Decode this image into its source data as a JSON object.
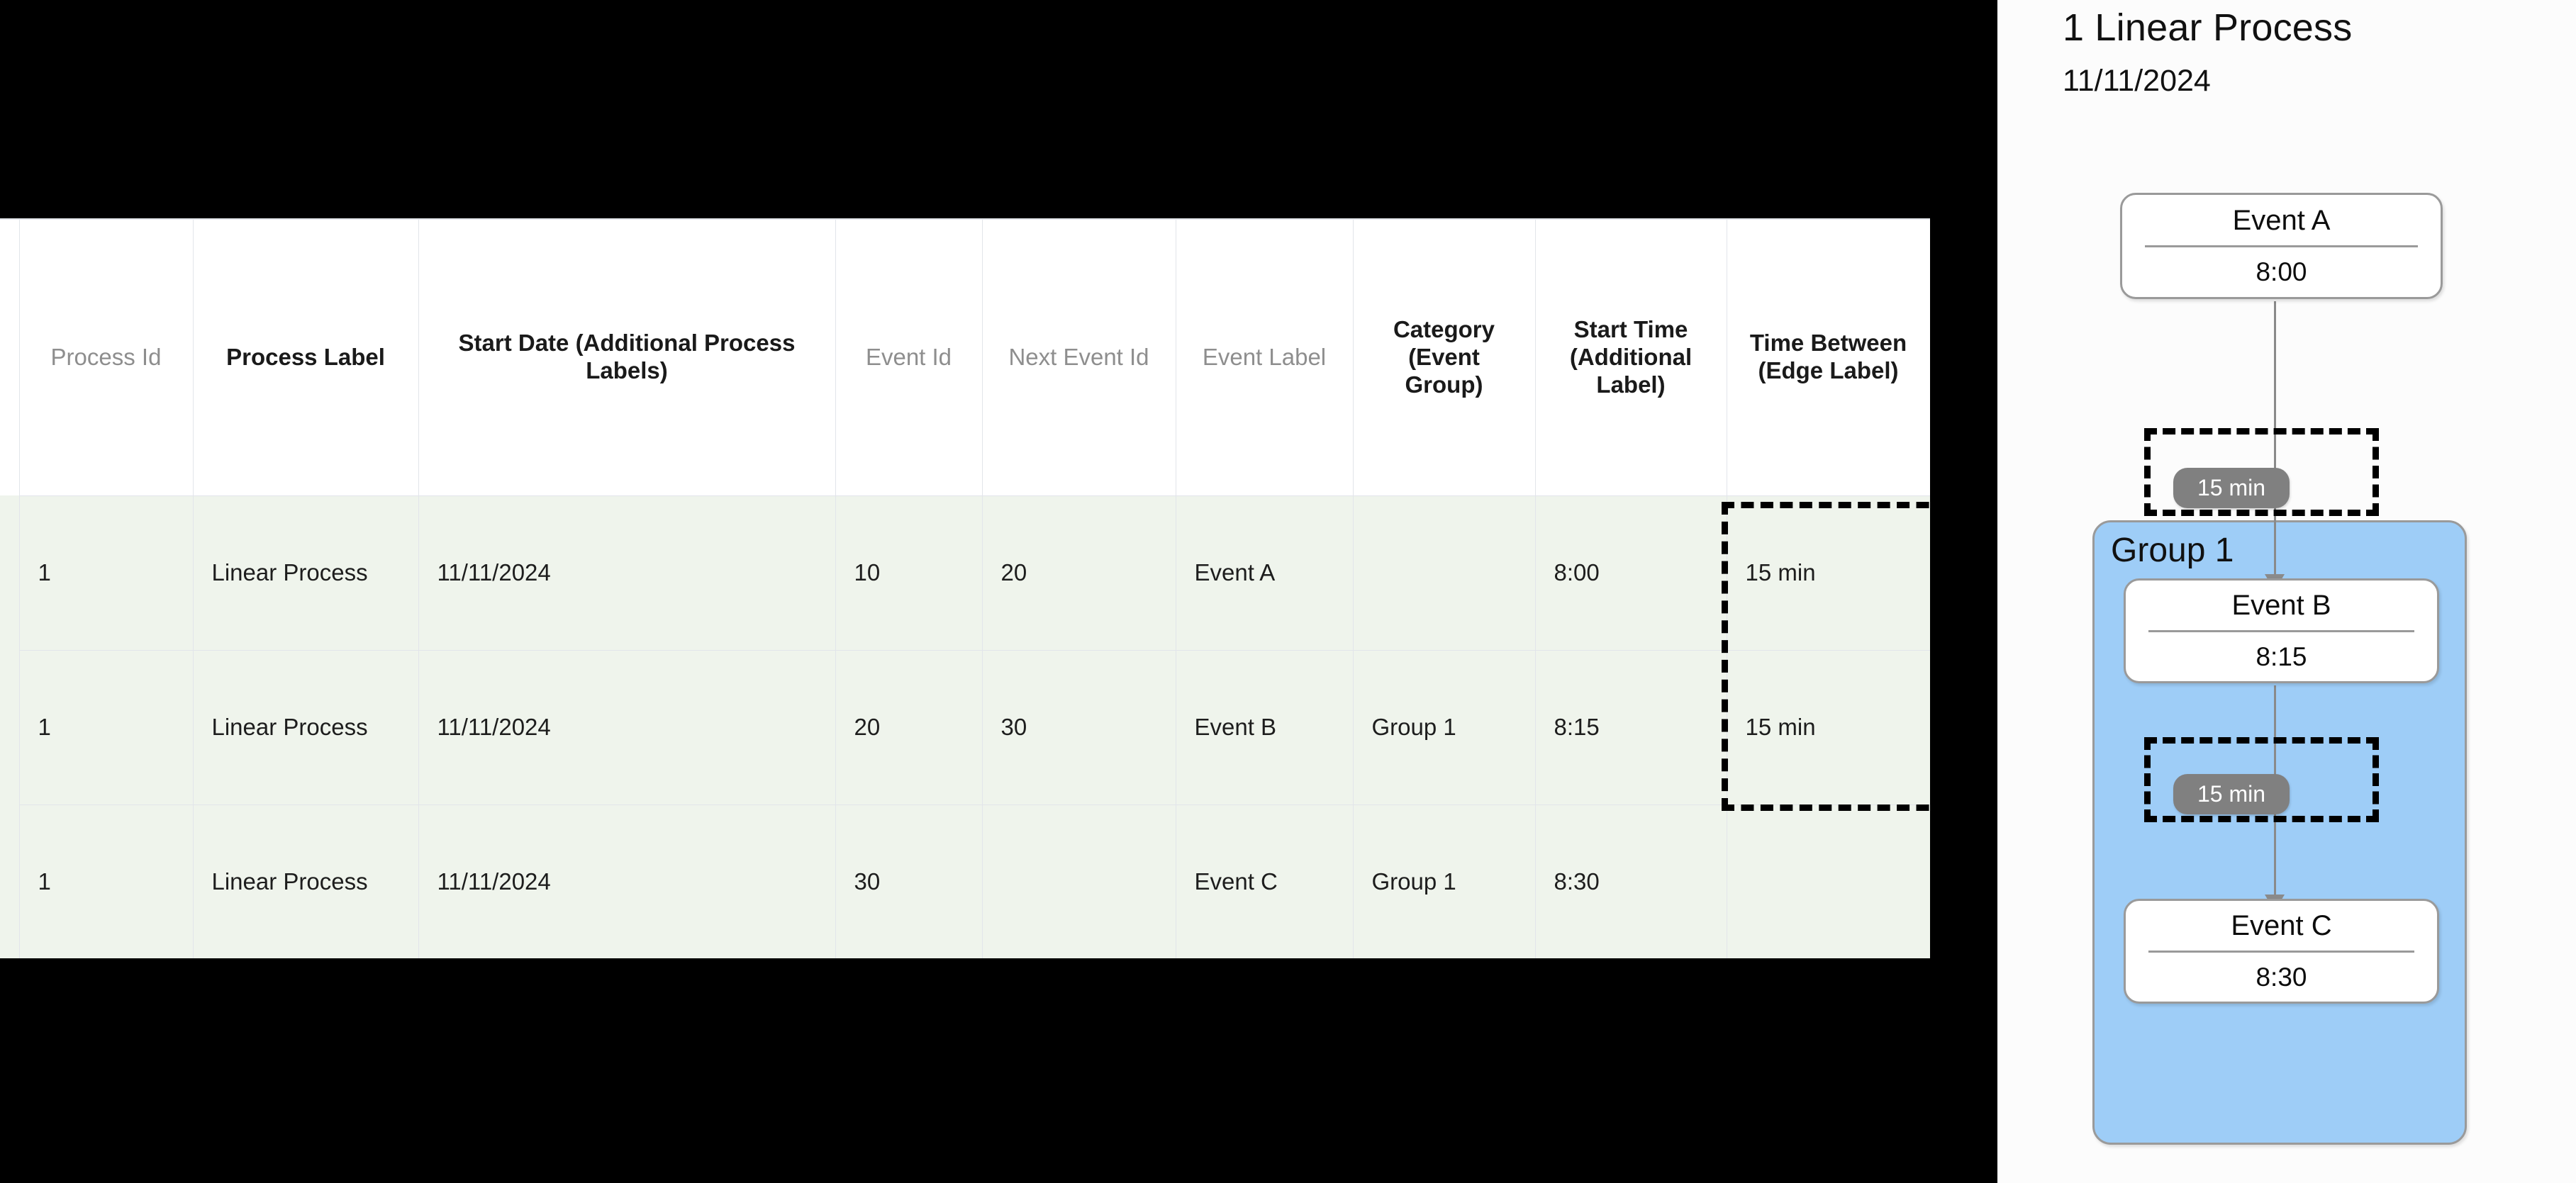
{
  "table": {
    "columns": [
      {
        "label": "Process\nId",
        "style": "muted"
      },
      {
        "label": "Process\nLabel",
        "style": "bold"
      },
      {
        "label": "Start Date (Additional\nProcess Labels)",
        "style": "bold"
      },
      {
        "label": "Event\nId",
        "style": "muted"
      },
      {
        "label": "Next\nEvent Id",
        "style": "muted"
      },
      {
        "label": "Event\nLabel",
        "style": "muted"
      },
      {
        "label": "Category\n(Event\nGroup)",
        "style": "bold"
      },
      {
        "label": "Start Time\n(Additional\nLabel)",
        "style": "bold"
      },
      {
        "label": "Time\nBetween\n(Edge\nLabel)",
        "style": "bold"
      }
    ],
    "headers": {
      "process_id": "Process Id",
      "process_label": "Process Label",
      "start_date": "Start Date (Additional Process Labels)",
      "event_id": "Event Id",
      "next_event_id": "Next Event Id",
      "event_label": "Event Label",
      "category": "Category (Event Group)",
      "start_time": "Start Time (Additional Label)",
      "time_between": "Time Between (Edge Label)"
    },
    "rows": [
      {
        "process_id": "1",
        "process_label": "Linear Process",
        "start_date": "11/11/2024",
        "event_id": "10",
        "next_event_id": "20",
        "event_label": "Event A",
        "category": "",
        "start_time": "8:00",
        "time_between": "15 min"
      },
      {
        "process_id": "1",
        "process_label": "Linear Process",
        "start_date": "11/11/2024",
        "event_id": "20",
        "next_event_id": "30",
        "event_label": "Event B",
        "category": "Group 1",
        "start_time": "8:15",
        "time_between": "15 min"
      },
      {
        "process_id": "1",
        "process_label": "Linear Process",
        "start_date": "11/11/2024",
        "event_id": "30",
        "next_event_id": "",
        "event_label": "Event C",
        "category": "Group 1",
        "start_time": "8:30",
        "time_between": ""
      }
    ]
  },
  "diagram": {
    "title": "1 Linear Process",
    "date": "11/11/2024",
    "group": {
      "label": "Group 1",
      "fill_color": "#9ecdf7",
      "border_color": "#9a9a9a"
    },
    "nodes": [
      {
        "label": "Event A",
        "time": "8:00"
      },
      {
        "label": "Event B",
        "time": "8:15"
      },
      {
        "label": "Event C",
        "time": "8:30"
      }
    ],
    "edges": [
      {
        "label": "15 min",
        "from": "Event A",
        "to": "Event B"
      },
      {
        "label": "15 min",
        "from": "Event B",
        "to": "Event C"
      }
    ],
    "edge_badge_color": "#808080",
    "edge_badge_text_color": "#ffffff",
    "highlight_border_color": "#000000",
    "node_border_color": "#9a9a9a",
    "node_fill_color": "#ffffff"
  },
  "colors": {
    "row_background": "#eff4ec",
    "grid_line": "#e2e5ea",
    "header_muted": "#8e8e8e",
    "header_bold": "#1a1a1a",
    "panel_background": "#fcfcfc",
    "page_background": "#000000"
  }
}
